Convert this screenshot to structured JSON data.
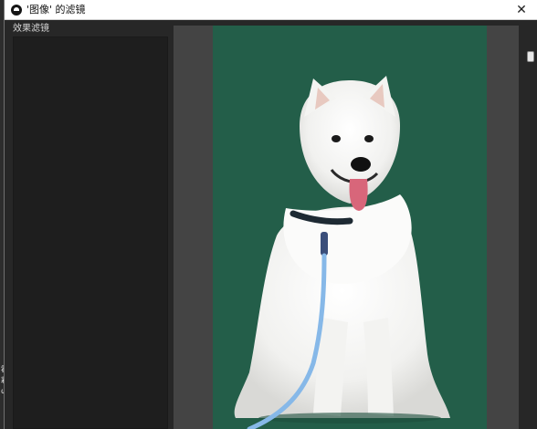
{
  "dialog": {
    "title": "'图像' 的滤镜",
    "close_glyph": "✕"
  },
  "left_panel": {
    "header": "效果滤镜"
  },
  "background_app": {
    "fragments": [
      "霍",
      "彩",
      "ω"
    ]
  },
  "preview": {
    "background_color": "#235e49",
    "subject": "white Samoyed dog on blue leash"
  }
}
